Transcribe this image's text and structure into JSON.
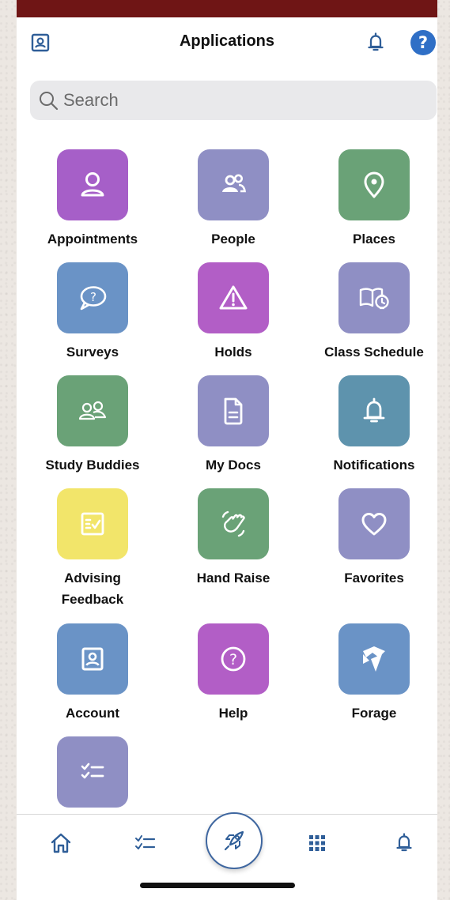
{
  "header": {
    "title": "Applications",
    "profile_icon": "id-card-icon",
    "bell_icon": "bell-icon",
    "help_label": "?"
  },
  "search": {
    "placeholder": "Search",
    "value": ""
  },
  "apps": [
    {
      "label": "Appointments",
      "color": "#a65fc8",
      "icon": "person-icon"
    },
    {
      "label": "People",
      "color": "#8f8fc4",
      "icon": "people-icon"
    },
    {
      "label": "Places",
      "color": "#6aa277",
      "icon": "location-pin-icon"
    },
    {
      "label": "Surveys",
      "color": "#6a93c6",
      "icon": "speech-bubble-question-icon"
    },
    {
      "label": "Holds",
      "color": "#b25ec6",
      "icon": "warning-triangle-icon"
    },
    {
      "label": "Class Schedule",
      "color": "#8f8fc4",
      "icon": "book-clock-icon"
    },
    {
      "label": "Study Buddies",
      "color": "#6aa277",
      "icon": "group-icon"
    },
    {
      "label": "My Docs",
      "color": "#8f8fc4",
      "icon": "document-icon"
    },
    {
      "label": "Notifications",
      "color": "#5e93ad",
      "icon": "bell-icon"
    },
    {
      "label": "Advising\nFeedback",
      "color": "#f2e56a",
      "icon": "checklist-board-icon"
    },
    {
      "label": "Hand Raise",
      "color": "#6aa277",
      "icon": "hand-wave-icon"
    },
    {
      "label": "Favorites",
      "color": "#8f8fc4",
      "icon": "heart-icon"
    },
    {
      "label": "Account",
      "color": "#6a93c6",
      "icon": "id-card-icon"
    },
    {
      "label": "Help",
      "color": "#b25ec6",
      "icon": "question-circle-icon"
    },
    {
      "label": "Forage",
      "color": "#6a93c6",
      "icon": "forage-logo-icon"
    },
    {
      "label": "",
      "color": "#8f8fc4",
      "icon": "checklist-icon"
    }
  ],
  "bottom_nav": [
    {
      "name": "home",
      "icon": "home-icon"
    },
    {
      "name": "tasks",
      "icon": "checklist-icon"
    },
    {
      "name": "launch",
      "icon": "rocket-icon"
    },
    {
      "name": "apps",
      "icon": "grid-icon"
    },
    {
      "name": "notifications",
      "icon": "bell-icon"
    }
  ],
  "colors": {
    "top_bar": "#6f1515",
    "accent_blue": "#2f6fc6",
    "nav_icon": "#2f5e98"
  }
}
